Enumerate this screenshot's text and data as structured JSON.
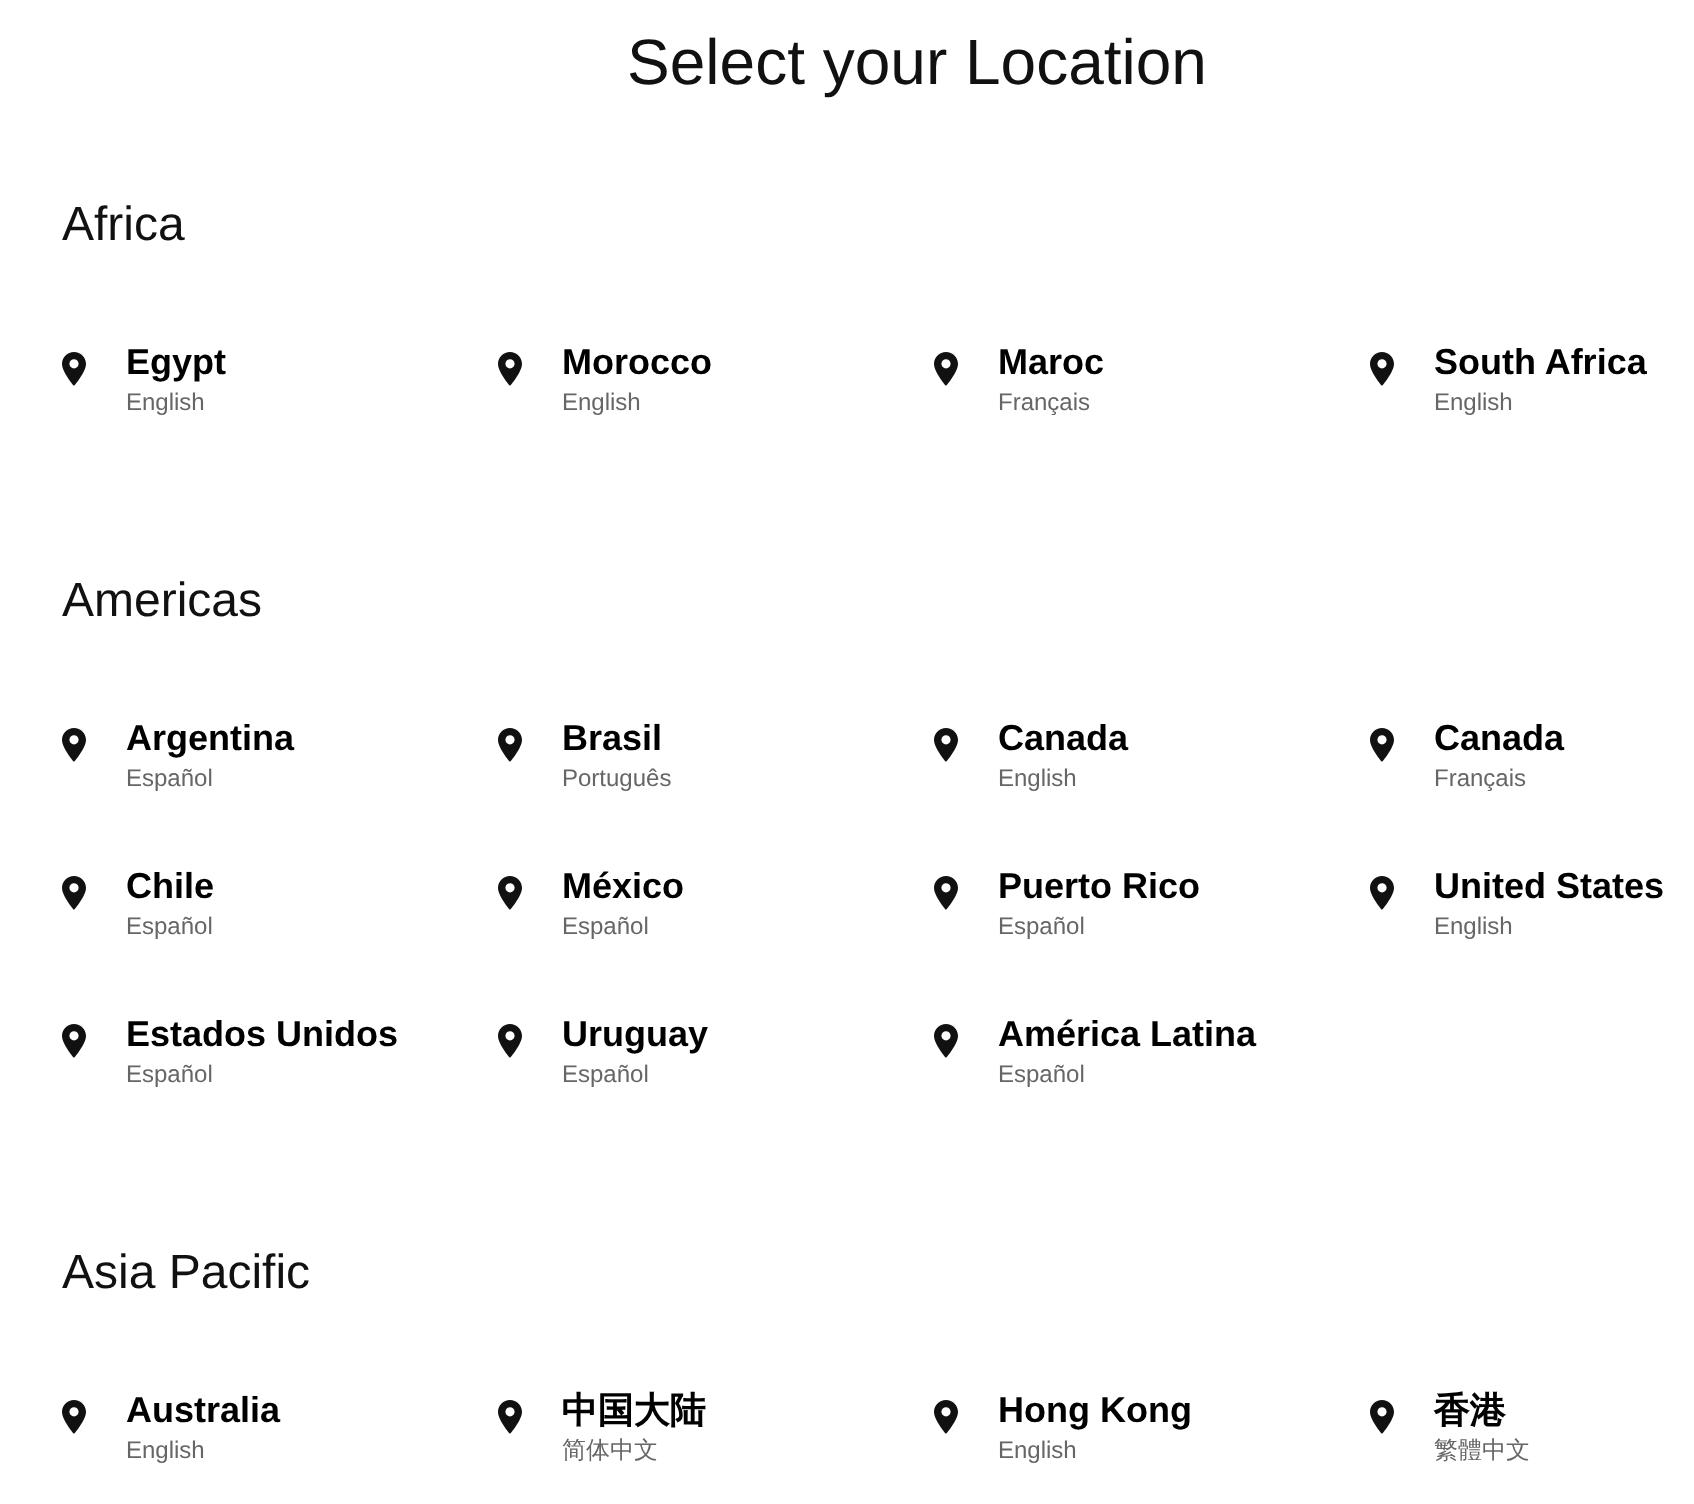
{
  "title": "Select your Location",
  "regions": [
    {
      "name": "Africa",
      "locations": [
        {
          "country": "Egypt",
          "language": "English"
        },
        {
          "country": "Morocco",
          "language": "English"
        },
        {
          "country": "Maroc",
          "language": "Français"
        },
        {
          "country": "South Africa",
          "language": "English"
        }
      ]
    },
    {
      "name": "Americas",
      "locations": [
        {
          "country": "Argentina",
          "language": "Español"
        },
        {
          "country": "Brasil",
          "language": "Português"
        },
        {
          "country": "Canada",
          "language": "English"
        },
        {
          "country": "Canada",
          "language": "Français"
        },
        {
          "country": "Chile",
          "language": "Español"
        },
        {
          "country": "México",
          "language": "Español"
        },
        {
          "country": "Puerto Rico",
          "language": "Español"
        },
        {
          "country": "United States",
          "language": "English"
        },
        {
          "country": "Estados Unidos",
          "language": "Español"
        },
        {
          "country": "Uruguay",
          "language": "Español"
        },
        {
          "country": "América Latina",
          "language": "Español"
        }
      ]
    },
    {
      "name": "Asia Pacific",
      "locations": [
        {
          "country": "Australia",
          "language": "English"
        },
        {
          "country": "中国大陆",
          "language": "简体中文"
        },
        {
          "country": "Hong Kong",
          "language": "English"
        },
        {
          "country": "香港",
          "language": "繁體中文"
        }
      ]
    }
  ]
}
